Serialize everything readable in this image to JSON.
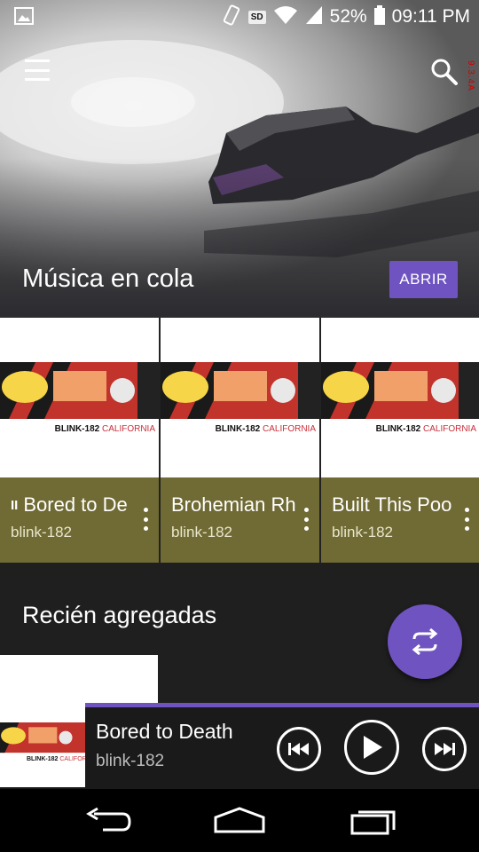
{
  "status_bar": {
    "battery": "52%",
    "time": "09:11 PM",
    "sd_label": "SD",
    "icons": [
      "image-icon",
      "vibrate-icon",
      "sd-card-icon",
      "wifi-icon",
      "signal-icon",
      "battery-icon"
    ]
  },
  "header": {
    "version": "9.3.4A",
    "menu_icon": "hamburger-menu-icon",
    "search_icon": "search-icon"
  },
  "hero": {
    "title": "Música en cola",
    "open_button": "ABRIR"
  },
  "queue": [
    {
      "title": "Bored to De",
      "artist": "blink-182",
      "playing": true
    },
    {
      "title": "Brohemian Rh",
      "artist": "blink-182",
      "playing": false
    },
    {
      "title": "Built This Poo",
      "artist": "blink-182",
      "playing": false
    }
  ],
  "album_art": {
    "band": "BLINK-182",
    "album": "CALIFORNIA"
  },
  "pause_glyph": "II",
  "recent": {
    "title": "Recién agregadas"
  },
  "now_playing": {
    "title": "Bored to Death",
    "artist": "blink-182"
  },
  "colors": {
    "accent": "#6f54c1",
    "card_info": "#706a34",
    "background": "#1f1f1f"
  }
}
